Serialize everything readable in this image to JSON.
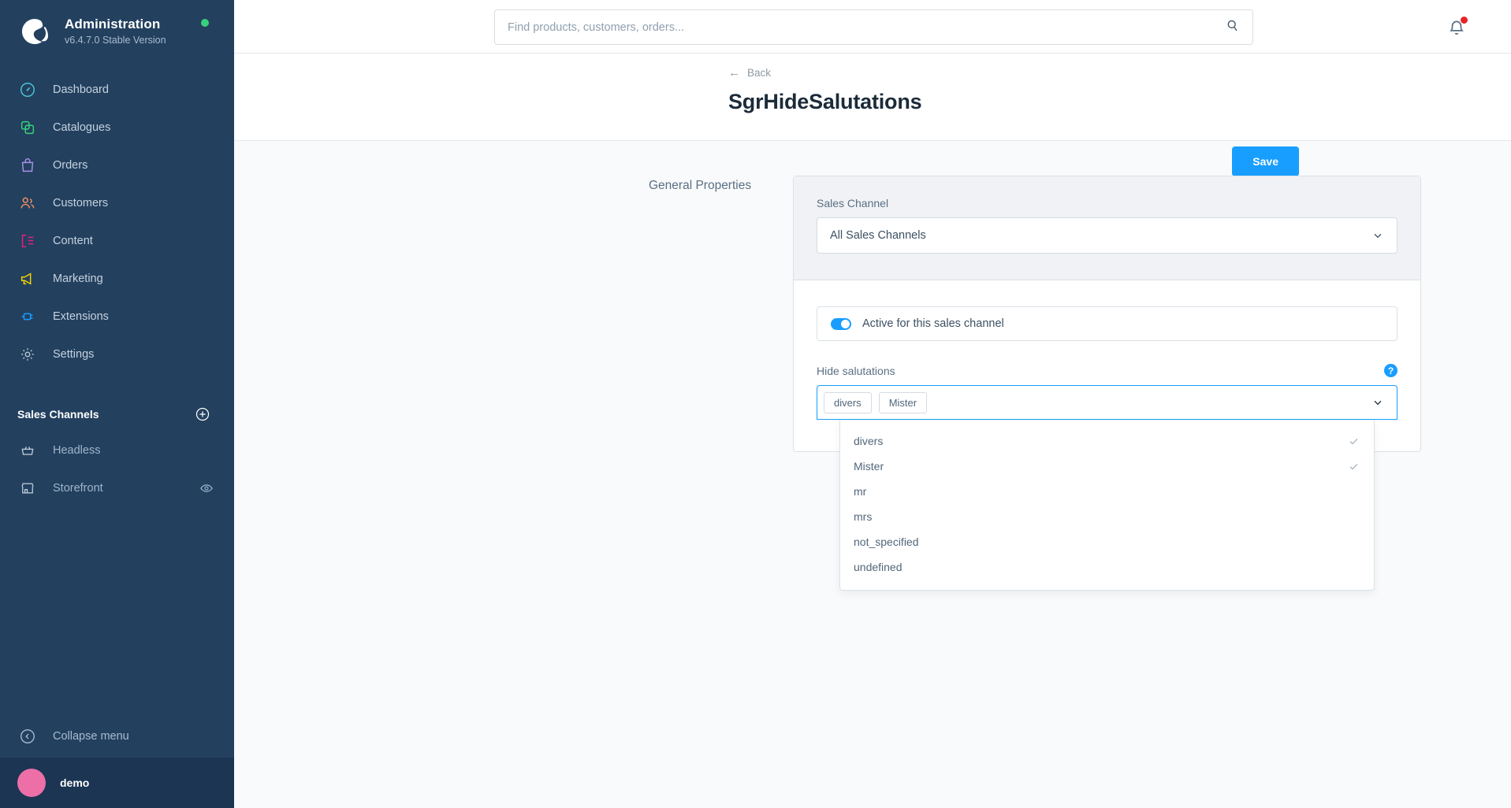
{
  "sidebar": {
    "brand": {
      "title": "Administration",
      "version": "v6.4.7.0 Stable Version",
      "logo_icon": "shopware-logo-icon",
      "status_icon": "status-dot-online"
    },
    "nav": [
      {
        "label": "Dashboard",
        "icon": "dashboard-icon",
        "color": "#4dc6d6"
      },
      {
        "label": "Catalogues",
        "icon": "catalogues-icon",
        "color": "#37d279"
      },
      {
        "label": "Orders",
        "icon": "orders-icon",
        "color": "#a98fe8"
      },
      {
        "label": "Customers",
        "icon": "customers-icon",
        "color": "#ef8d63"
      },
      {
        "label": "Content",
        "icon": "content-icon",
        "color": "#ee1c7f"
      },
      {
        "label": "Marketing",
        "icon": "marketing-icon",
        "color": "#f5d300"
      },
      {
        "label": "Extensions",
        "icon": "extensions-icon",
        "color": "#189eff"
      },
      {
        "label": "Settings",
        "icon": "settings-gear-icon",
        "color": "#b6c1cc"
      }
    ],
    "section": {
      "title": "Sales Channels",
      "add_icon": "plus-circle-icon"
    },
    "channels": [
      {
        "label": "Headless",
        "icon": "basket-icon",
        "trailing_icon": ""
      },
      {
        "label": "Storefront",
        "icon": "storefront-icon",
        "trailing_icon": "eye-icon"
      }
    ],
    "collapse": {
      "label": "Collapse menu",
      "icon": "chevron-left-circle-icon"
    },
    "user": {
      "name": "demo",
      "avatar_icon": "avatar-icon"
    }
  },
  "topbar": {
    "search": {
      "placeholder": "Find products, customers, orders...",
      "value": "",
      "icon": "search-icon"
    },
    "notifications": {
      "icon": "bell-icon",
      "badge_icon": "notification-dot",
      "badge_color": "#e52427"
    }
  },
  "header": {
    "back_label": "Back",
    "back_icon": "arrow-left-icon",
    "title": "SgrHideSalutations",
    "save_label": "Save",
    "save_color": "#189eff"
  },
  "content": {
    "section_label": "General Properties",
    "sales_channel": {
      "label": "Sales Channel",
      "value": "All Sales Channels",
      "chevron_icon": "chevron-down-icon"
    },
    "active_toggle": {
      "label": "Active for this sales channel",
      "state": "on",
      "color": "#189eff"
    },
    "hide_salutations": {
      "label": "Hide salutations",
      "help_icon": "help-circle-icon",
      "help_glyph": "?",
      "chevron_icon": "chevron-down-icon",
      "selected": [
        "divers",
        "Mister"
      ],
      "options": [
        {
          "label": "divers",
          "selected": true
        },
        {
          "label": "Mister",
          "selected": true
        },
        {
          "label": "mr",
          "selected": false
        },
        {
          "label": "mrs",
          "selected": false
        },
        {
          "label": "not_specified",
          "selected": false
        },
        {
          "label": "undefined",
          "selected": false
        }
      ]
    }
  }
}
